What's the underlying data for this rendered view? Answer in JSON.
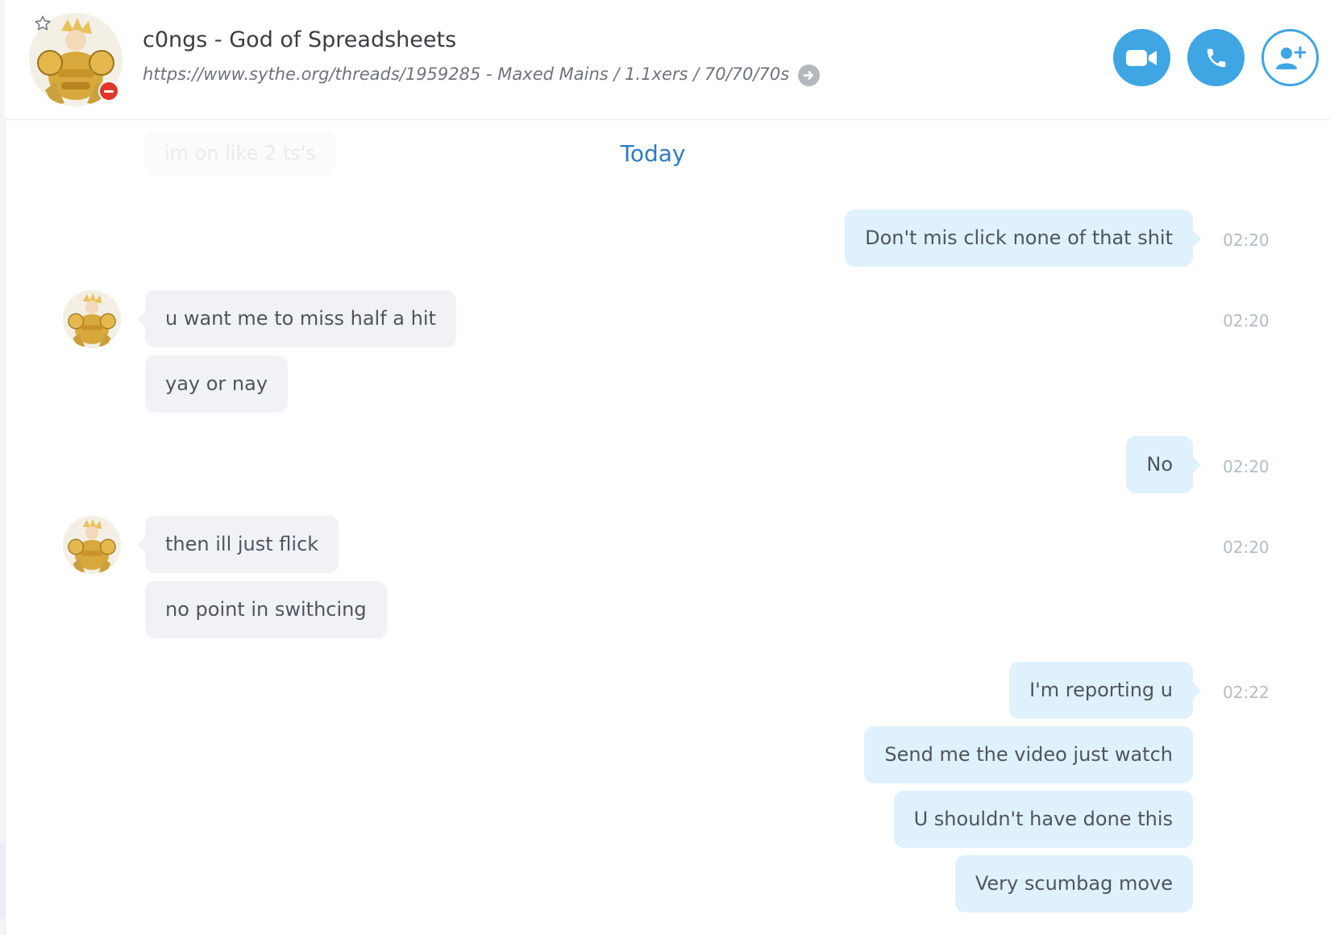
{
  "header": {
    "title": "c0ngs - God of Spreadsheets",
    "mood": "https://www.sythe.org/threads/1959285 - Maxed Mains / 1.1xers / 70/70/70s",
    "buttons": {
      "video": "video-call",
      "call": "audio-call",
      "add": "add-people"
    }
  },
  "conversation": {
    "faded_preview": "im on like 2 ts's",
    "date_divider": "Today",
    "groups": [
      {
        "direction": "outgoing",
        "time": "02:20",
        "messages": [
          "Don't mis click none of that shit"
        ]
      },
      {
        "direction": "incoming",
        "time": "02:20",
        "messages": [
          "u want me to miss half a hit",
          "yay or nay"
        ]
      },
      {
        "direction": "outgoing",
        "time": "02:20",
        "messages": [
          "No"
        ]
      },
      {
        "direction": "incoming",
        "time": "02:20",
        "messages": [
          "then ill just flick",
          "no point in swithcing"
        ]
      },
      {
        "direction": "outgoing",
        "time": "02:22",
        "messages": [
          "I'm reporting u",
          "Send me the video just watch",
          "U shouldn't have done this",
          "Very scumbag move"
        ]
      }
    ]
  },
  "colors": {
    "accent": "#3fa5e3",
    "outgoing_bubble": "#dff1fc",
    "incoming_bubble": "#f0f2f6",
    "today_text": "#2f7bbf",
    "timestamp": "#b3bcc6",
    "presence_busy": "#e0352b"
  },
  "icons": {
    "favorite": "star-outline-icon",
    "mood_link": "arrow-right-circle-icon",
    "video": "video-camera-icon",
    "call": "phone-icon",
    "add": "add-person-icon"
  }
}
